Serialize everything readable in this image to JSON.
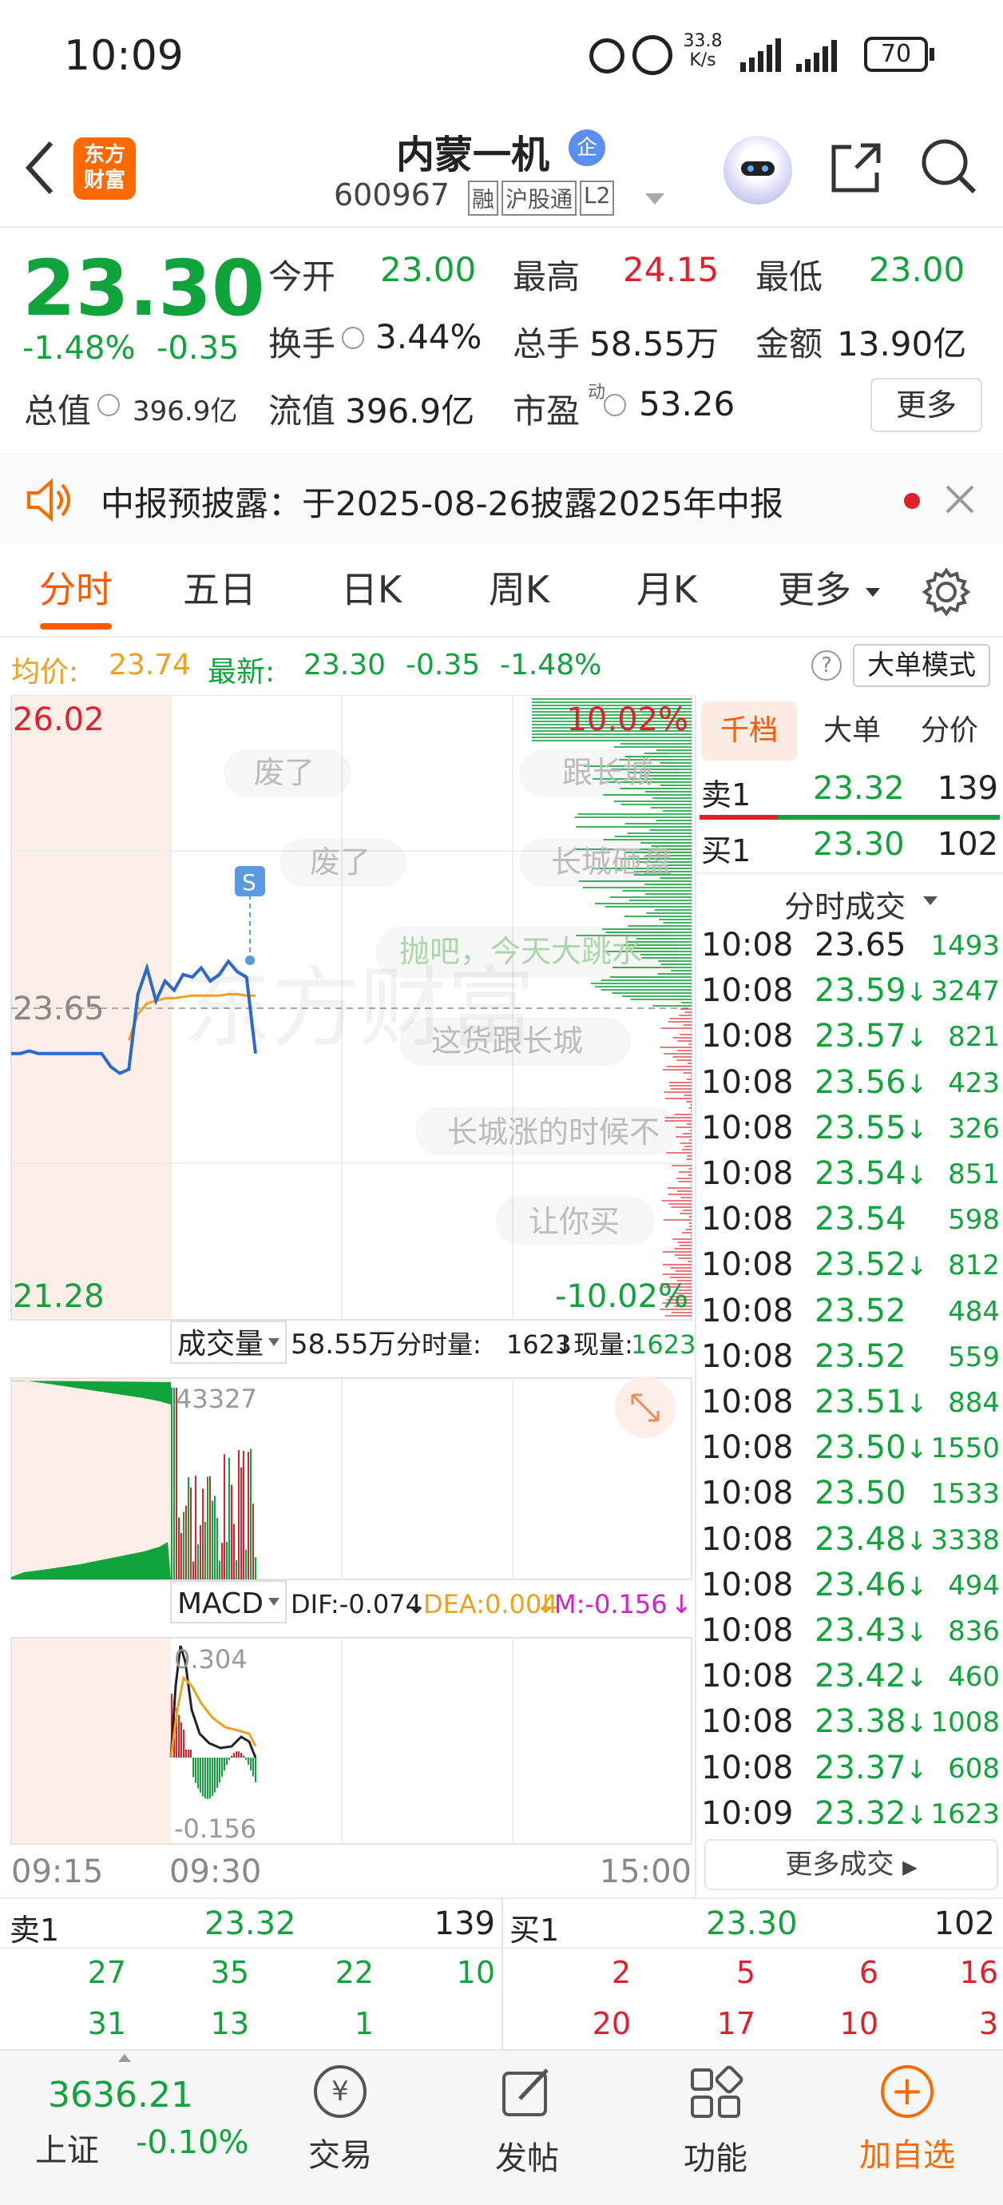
{
  "status_bar": {
    "time": "10:09",
    "net_speed_value": "33.8",
    "net_speed_unit": "K/s",
    "battery": "70"
  },
  "header": {
    "logo_line1": "东方",
    "logo_line2": "财富",
    "stock_name": "内蒙一机",
    "enterprise_badge": "企",
    "stock_code": "600967",
    "tags": [
      "融",
      "沪股通",
      "L2"
    ]
  },
  "quote": {
    "price": "23.30",
    "change_pct": "-1.48%",
    "change": "-0.35",
    "open_label": "今开",
    "open": "23.00",
    "high_label": "最高",
    "high": "24.15",
    "low_label": "最低",
    "low": "23.00",
    "turnover_rate_label": "换手",
    "turnover_rate": "3.44%",
    "volume_label": "总手",
    "volume": "58.55万",
    "amount_label": "金额",
    "amount": "13.90亿",
    "market_cap_label": "总值",
    "market_cap": "396.9亿",
    "float_cap_label": "流值",
    "float_cap": "396.9亿",
    "pe_label": "市盈",
    "pe_sup": "动",
    "pe": "53.26",
    "more_button": "更多"
  },
  "notice": {
    "text": "中报预披露：于2025-08-26披露2025年中报"
  },
  "tabs": {
    "items": [
      "分时",
      "五日",
      "日K",
      "周K",
      "月K",
      "更多"
    ],
    "active": "分时"
  },
  "avg_line": {
    "avg_label": "均价:",
    "avg_value": "23.74",
    "latest_label": "最新:",
    "latest_value": "23.30",
    "latest_change": "-0.35",
    "latest_pct": "-1.48%",
    "help": "?",
    "big_order_button": "大单模式"
  },
  "chart": {
    "y_max": "26.02",
    "y_mid": "23.65",
    "y_min": "21.28",
    "pct_max": "10.02%",
    "pct_min": "-10.02%",
    "s_marker": "S",
    "watermark": "东方财富",
    "danmaku": [
      "废了",
      "跟长城",
      "废了",
      "长城砸盘",
      "抛吧，今天大跳水",
      "这货跟长城",
      "长城涨的时候不",
      "让你买"
    ],
    "volume_panel": {
      "label": "成交量",
      "total": "58.55万",
      "minute_vol_label": "分时量:",
      "minute_vol": "1623",
      "current_vol_label": "现量:",
      "current_vol": "1623",
      "max_label": "43327"
    },
    "macd_panel": {
      "label": "MACD",
      "dif": "DIF:-0.074",
      "dea": "DEA:0.004",
      "m": "M:-0.156",
      "top_label": "0.304",
      "bottom_label": "-0.156"
    },
    "time_axis": [
      "09:15",
      "09:30",
      "15:00"
    ]
  },
  "chart_data": {
    "type": "line",
    "title": "",
    "xlabel": "",
    "ylabel": "",
    "ylim": [
      21.28,
      26.02
    ],
    "prev_close": 23.65,
    "series": [
      {
        "values": [
          23.3,
          23.3,
          23.32,
          23.3,
          23.3,
          23.3,
          23.3,
          23.3,
          23.3,
          23.3,
          23.3,
          23.2,
          23.15,
          23.18,
          23.75,
          23.95,
          23.7,
          23.85,
          23.78,
          23.9,
          23.88,
          23.95,
          23.85,
          23.9,
          24.0,
          23.92,
          23.88,
          23.3
        ]
      },
      {
        "values": [
          23.4,
          23.4,
          23.4,
          23.4,
          23.4,
          23.4,
          23.4,
          23.4,
          23.4,
          23.4,
          23.4,
          23.4,
          23.4,
          23.4,
          23.6,
          23.68,
          23.7,
          23.72,
          23.72,
          23.73,
          23.74,
          23.74,
          23.74,
          23.74,
          23.75,
          23.75,
          23.74,
          23.74
        ]
      }
    ]
  },
  "ticks": {
    "tabs": [
      "千档",
      "大单",
      "分价"
    ],
    "sell1_label": "卖1",
    "sell1_price": "23.32",
    "sell1_vol": "139",
    "buy1_label": "买1",
    "buy1_price": "23.30",
    "buy1_vol": "102",
    "list_title": "分时成交",
    "rows": [
      {
        "time": "10:08",
        "price": "23.65",
        "arrow": "",
        "vol": "1493",
        "pc": "black",
        "vc": "green"
      },
      {
        "time": "10:08",
        "price": "23.59",
        "arrow": "↓",
        "vol": "3247",
        "pc": "green",
        "vc": "green"
      },
      {
        "time": "10:08",
        "price": "23.57",
        "arrow": "↓",
        "vol": "821",
        "pc": "green",
        "vc": "green"
      },
      {
        "time": "10:08",
        "price": "23.56",
        "arrow": "↓",
        "vol": "423",
        "pc": "green",
        "vc": "green"
      },
      {
        "time": "10:08",
        "price": "23.55",
        "arrow": "↓",
        "vol": "326",
        "pc": "green",
        "vc": "green"
      },
      {
        "time": "10:08",
        "price": "23.54",
        "arrow": "↓",
        "vol": "851",
        "pc": "green",
        "vc": "green"
      },
      {
        "time": "10:08",
        "price": "23.54",
        "arrow": "",
        "vol": "598",
        "pc": "green",
        "vc": "green"
      },
      {
        "time": "10:08",
        "price": "23.52",
        "arrow": "↓",
        "vol": "812",
        "pc": "green",
        "vc": "green"
      },
      {
        "time": "10:08",
        "price": "23.52",
        "arrow": "",
        "vol": "484",
        "pc": "green",
        "vc": "green"
      },
      {
        "time": "10:08",
        "price": "23.52",
        "arrow": "",
        "vol": "559",
        "pc": "green",
        "vc": "green"
      },
      {
        "time": "10:08",
        "price": "23.51",
        "arrow": "↓",
        "vol": "884",
        "pc": "green",
        "vc": "green"
      },
      {
        "time": "10:08",
        "price": "23.50",
        "arrow": "↓",
        "vol": "1550",
        "pc": "green",
        "vc": "green"
      },
      {
        "time": "10:08",
        "price": "23.50",
        "arrow": "",
        "vol": "1533",
        "pc": "green",
        "vc": "green"
      },
      {
        "time": "10:08",
        "price": "23.48",
        "arrow": "↓",
        "vol": "3338",
        "pc": "green",
        "vc": "green"
      },
      {
        "time": "10:08",
        "price": "23.46",
        "arrow": "↓",
        "vol": "494",
        "pc": "green",
        "vc": "green"
      },
      {
        "time": "10:08",
        "price": "23.43",
        "arrow": "↓",
        "vol": "836",
        "pc": "green",
        "vc": "green"
      },
      {
        "time": "10:08",
        "price": "23.42",
        "arrow": "↓",
        "vol": "460",
        "pc": "green",
        "vc": "green"
      },
      {
        "time": "10:08",
        "price": "23.38",
        "arrow": "↓",
        "vol": "1008",
        "pc": "green",
        "vc": "green"
      },
      {
        "time": "10:08",
        "price": "23.37",
        "arrow": "↓",
        "vol": "608",
        "pc": "green",
        "vc": "green"
      },
      {
        "time": "10:09",
        "price": "23.32",
        "arrow": "↓",
        "vol": "1623",
        "pc": "green",
        "vc": "green"
      }
    ],
    "more_button": "更多成交"
  },
  "depth": {
    "sell_label": "卖1",
    "sell_price": "23.32",
    "sell_vol": "139",
    "buy_label": "买1",
    "buy_price": "23.30",
    "buy_vol": "102",
    "sell_row1": [
      "27",
      "35",
      "22",
      "10"
    ],
    "sell_row2": [
      "31",
      "13",
      "1"
    ],
    "buy_row1": [
      "2",
      "5",
      "6",
      "16"
    ],
    "buy_row2": [
      "20",
      "17",
      "10",
      "3"
    ]
  },
  "bottom_nav": {
    "index_value": "3636.21",
    "index_name": "上证",
    "index_change": "-0.10%",
    "items": [
      "交易",
      "发帖",
      "功能",
      "加自选"
    ]
  },
  "colors": {
    "up": "#e0202a",
    "down": "#11a33c",
    "accent": "#ff6a00",
    "price_line": "#2a6ad0",
    "avg_line": "#f0a020"
  }
}
